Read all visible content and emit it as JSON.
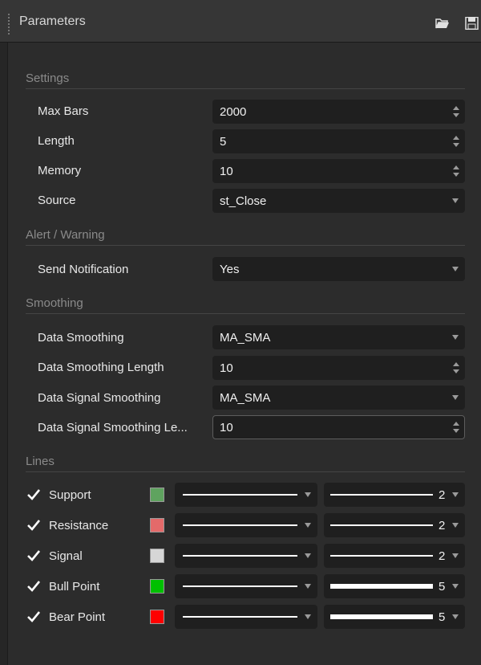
{
  "window": {
    "title": "Parameters"
  },
  "toolbar": {
    "open_icon": "folder-open-icon",
    "save_icon": "save-icon"
  },
  "sections": {
    "settings": "Settings",
    "alert": "Alert / Warning",
    "smoothing": "Smoothing",
    "lines": "Lines"
  },
  "settings": {
    "max_bars": {
      "label": "Max Bars",
      "value": "2000"
    },
    "length": {
      "label": "Length",
      "value": "5"
    },
    "memory": {
      "label": "Memory",
      "value": "10"
    },
    "source": {
      "label": "Source",
      "value": "st_Close"
    }
  },
  "alert": {
    "send_notification": {
      "label": "Send Notification",
      "value": "Yes"
    }
  },
  "smoothing": {
    "data_smoothing": {
      "label": "Data Smoothing",
      "value": "MA_SMA"
    },
    "data_smoothing_length": {
      "label": "Data Smoothing Length",
      "value": "10"
    },
    "data_signal_smoothing": {
      "label": "Data Signal Smoothing",
      "value": "MA_SMA"
    },
    "data_signal_smoothing_length": {
      "label": "Data Signal Smoothing Le...",
      "value": "10"
    }
  },
  "lines": [
    {
      "label": "Support",
      "checked": true,
      "color": "#5fa35f",
      "width": "2"
    },
    {
      "label": "Resistance",
      "checked": true,
      "color": "#e46a6a",
      "width": "2"
    },
    {
      "label": "Signal",
      "checked": true,
      "color": "#d6d6d6",
      "width": "2"
    },
    {
      "label": "Bull Point",
      "checked": true,
      "color": "#00c000",
      "width": "5"
    },
    {
      "label": "Bear Point",
      "checked": true,
      "color": "#ff0000",
      "width": "5"
    }
  ]
}
